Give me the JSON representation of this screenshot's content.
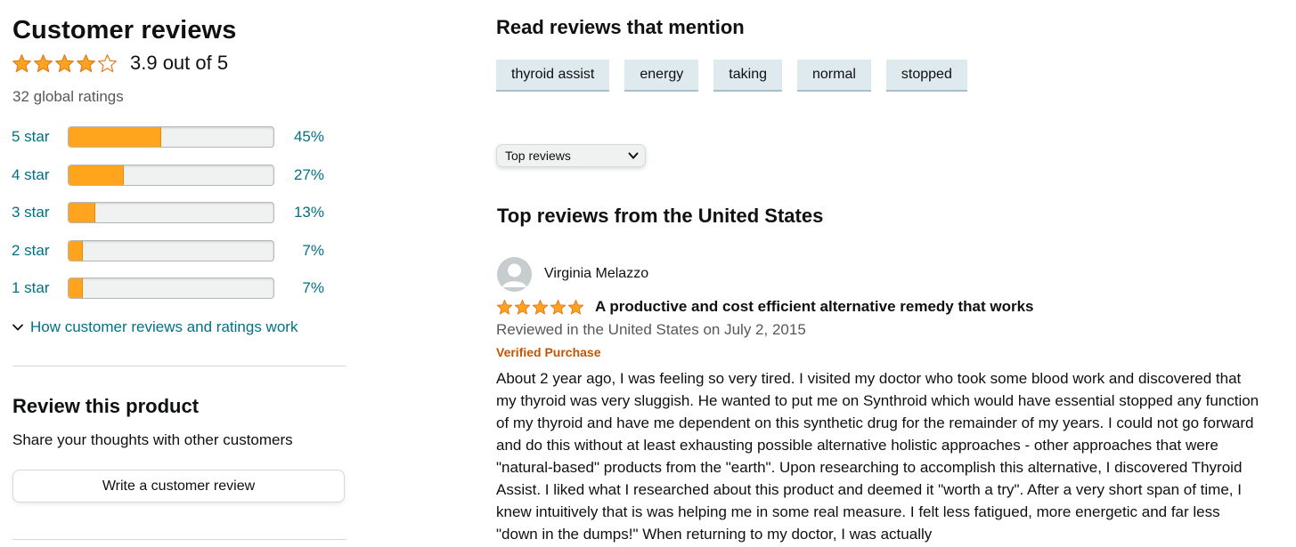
{
  "customer_reviews": {
    "title": "Customer reviews",
    "average_rating": 3.9,
    "average_text": "3.9 out of 5",
    "global_ratings": "32 global ratings",
    "histogram": [
      {
        "label": "5 star",
        "percent_text": "45%",
        "fraction": 0.45
      },
      {
        "label": "4 star",
        "percent_text": "27%",
        "fraction": 0.27
      },
      {
        "label": "3 star",
        "percent_text": "13%",
        "fraction": 0.13
      },
      {
        "label": "2 star",
        "percent_text": "7%",
        "fraction": 0.07
      },
      {
        "label": "1 star",
        "percent_text": "7%",
        "fraction": 0.07
      }
    ],
    "how_link": "How customer reviews and ratings work"
  },
  "review_product": {
    "title": "Review this product",
    "subtitle": "Share your thoughts with other customers",
    "button_label": "Write a customer review"
  },
  "mentions": {
    "title": "Read reviews that mention",
    "pills": [
      "thyroid assist",
      "energy",
      "taking",
      "normal",
      "stopped"
    ]
  },
  "sort": {
    "selected": "Top reviews"
  },
  "top_reviews": {
    "title": "Top reviews from the United States",
    "review": {
      "reviewer": "Virginia Melazzo",
      "rating": 5,
      "title": "A productive and cost efficient alternative remedy that works",
      "date": "Reviewed in the United States on July 2, 2015",
      "verified": "Verified Purchase",
      "body": "About 2 year ago, I was feeling so very tired. I visited my doctor who took some blood work and discovered that my thyroid was very sluggish. He wanted to put me on Synthroid which would have essential stopped any function of my thyroid and have me dependent on this synthetic drug for the remainder of my years. I could not go forward and do this without at least exhausting possible alternative holistic approaches - other approaches that were \"natural-based\" products from the \"earth\". Upon researching to accomplish this alternative, I discovered Thyroid Assist. I liked what I researched about this product and deemed it \"worth a try\". After a very short span of time, I knew intuitively that is was helping me in some real measure. I felt less fatigued, more energetic and far less \"down in the dumps!\" When returning to my doctor, I was actually"
    }
  },
  "colors": {
    "star_fill": "#ffa41c",
    "link": "#007185",
    "verified": "#c45500",
    "pill_bg": "#dfeaef"
  }
}
